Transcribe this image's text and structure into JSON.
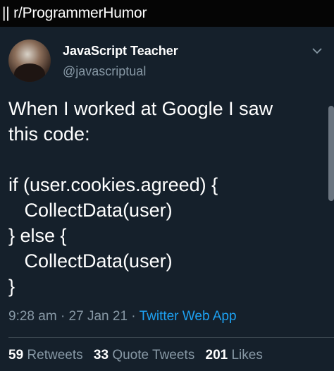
{
  "header": {
    "subreddit": "r/ProgrammerHumor"
  },
  "tweet": {
    "display_name": "JavaScript Teacher",
    "handle": "@javascriptual",
    "text": "When I worked at Google I saw\nthis code:\n\nif (user.cookies.agreed) {\n   CollectData(user)\n} else {\n   CollectData(user)\n}",
    "time": "9:28 am",
    "date": "27 Jan 21",
    "separator": "·",
    "source": "Twitter Web App",
    "retweets_count": "59",
    "retweets_label": "Retweets",
    "quote_tweets_count": "33",
    "quote_tweets_label": "Quote Tweets",
    "likes_count": "201",
    "likes_label": "Likes"
  },
  "colors": {
    "background": "#15202b",
    "secondary_text": "#8899a6",
    "link": "#1da1f2"
  },
  "icons": {
    "more": "chevron-down-icon",
    "avatar": "avatar"
  }
}
